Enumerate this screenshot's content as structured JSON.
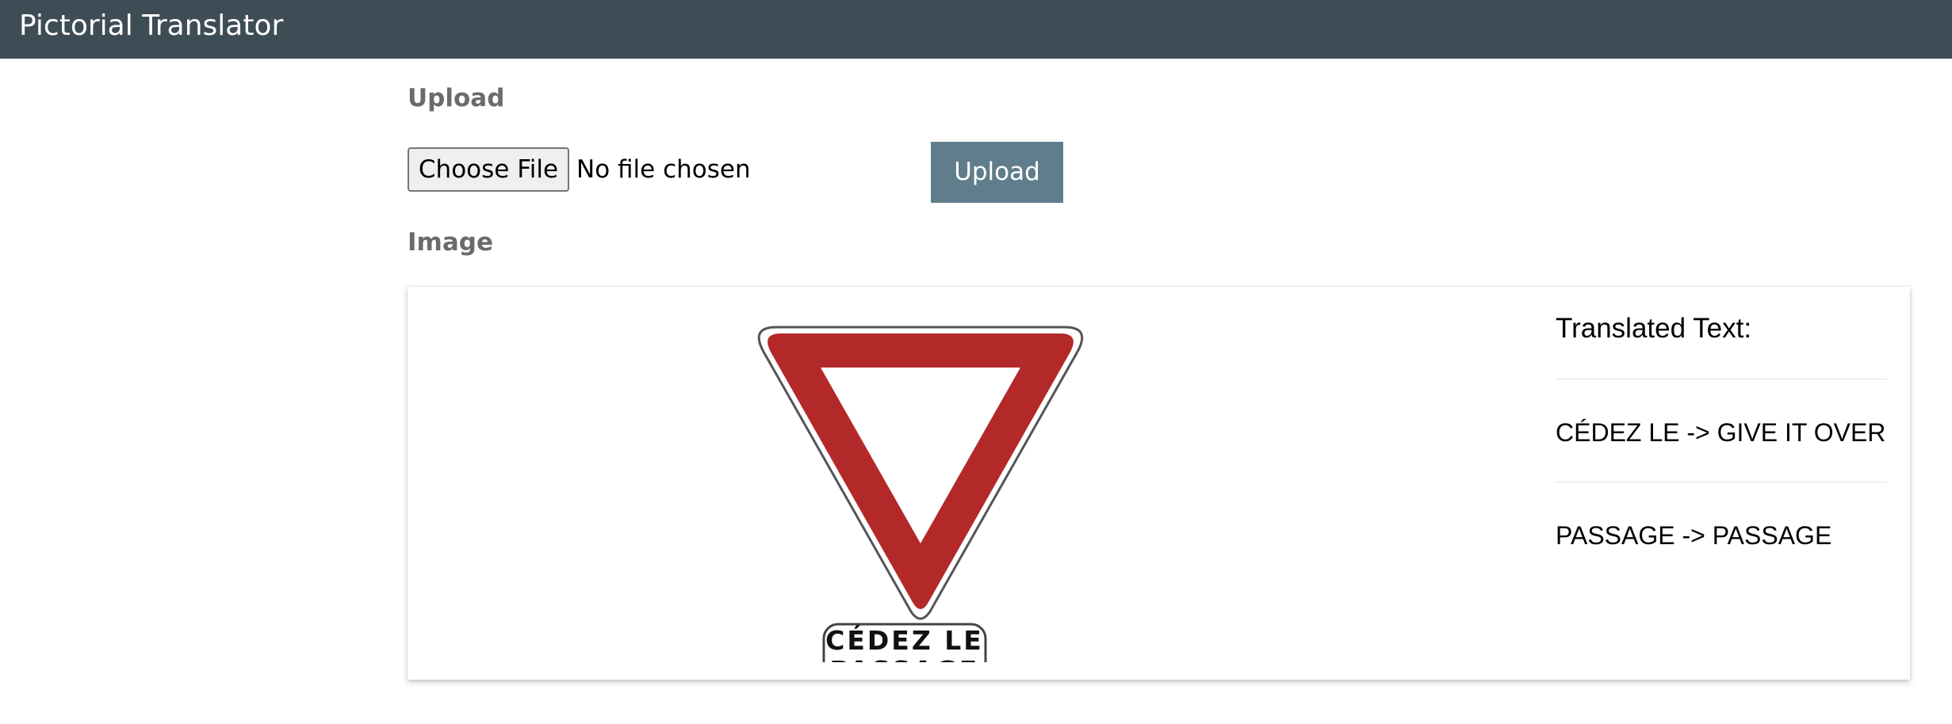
{
  "header": {
    "title": "Pictorial Translator",
    "background_color": "#3e4d55"
  },
  "upload_section": {
    "heading": "Upload",
    "file_button_label": "Choose File",
    "file_status": "No file chosen",
    "upload_button_label": "Upload",
    "upload_button_color": "#607d8b"
  },
  "image_section": {
    "heading": "Image",
    "sign": {
      "text_line_1": "CÉDEZ LE",
      "text_line_2": "PASSAGE",
      "border_color": "#b3292a"
    },
    "translations": {
      "title": "Translated Text:",
      "items": [
        "CÉDEZ LE -> GIVE IT OVER",
        "PASSAGE -> PASSAGE"
      ]
    }
  }
}
